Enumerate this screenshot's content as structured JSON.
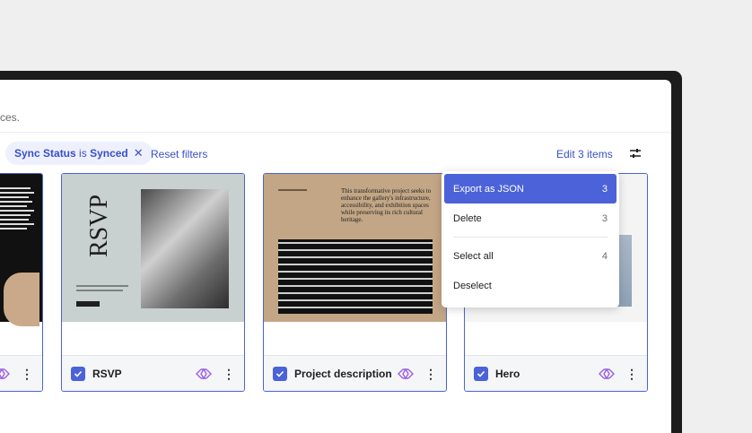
{
  "description_fragment": "rces.",
  "filter_chip": {
    "field": "Sync Status",
    "operator": "is",
    "value": "Synced",
    "remove_icon": "close-icon"
  },
  "reset_filters": "Reset filters",
  "edit_items": "Edit 3 items",
  "filter_settings_icon": "sliders-icon",
  "cards": [
    {
      "title": "",
      "checked": true,
      "synced": true
    },
    {
      "title": "RSVP",
      "checked": true,
      "synced": true,
      "thumb_title": "RSVP"
    },
    {
      "title": "Project description",
      "checked": true,
      "synced": true,
      "thumb_text": "This transformative project seeks to enhance the gallery's infrastructure, accessibility, and exhibition spaces while preserving its rich cultural heritage."
    },
    {
      "title": "Hero",
      "checked": true,
      "synced": true
    }
  ],
  "menu": {
    "items": [
      {
        "label": "Export as JSON",
        "count": "3",
        "active": true
      },
      {
        "label": "Delete",
        "count": "3"
      },
      {
        "label": "Select all",
        "count": "4"
      },
      {
        "label": "Deselect",
        "count": ""
      }
    ]
  },
  "colors": {
    "accent": "#4b62d8",
    "sync_icon": "#9b5fe0",
    "thumb_sage": "#c9d0d0",
    "thumb_tan": "#c2a685"
  }
}
